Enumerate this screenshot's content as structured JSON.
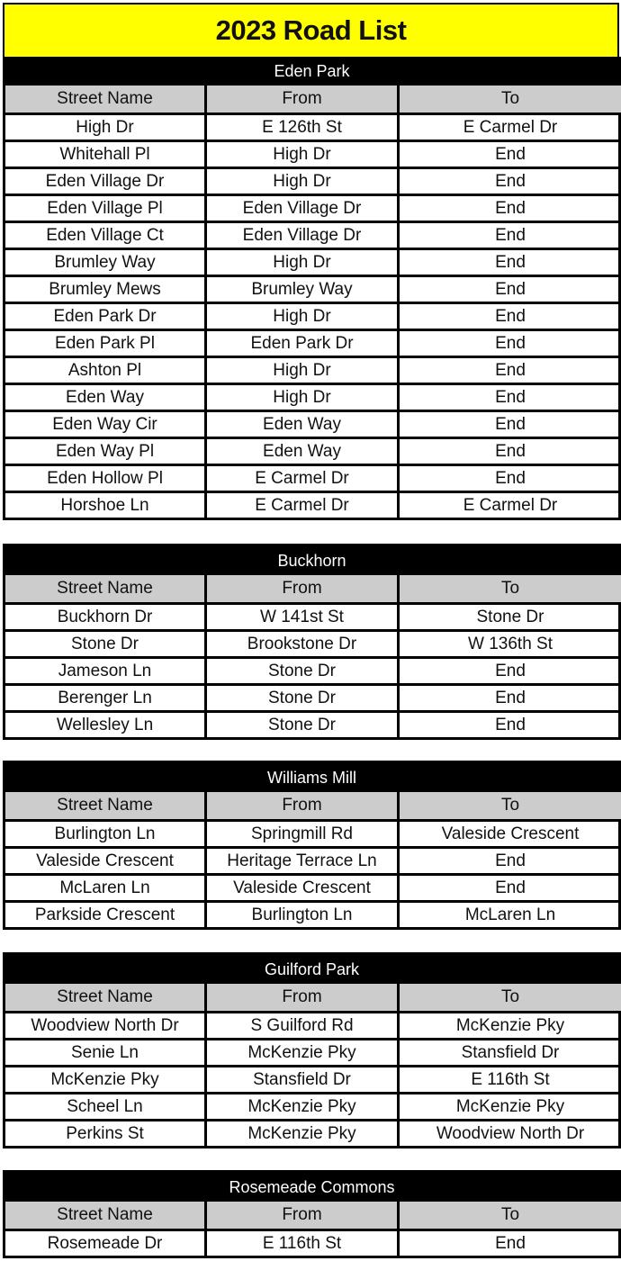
{
  "title": "2023 Road List",
  "columns": [
    "Street Name",
    "From",
    "To"
  ],
  "sections": [
    {
      "name": "Eden Park",
      "rows": [
        [
          "High Dr",
          "E 126th St",
          "E Carmel Dr"
        ],
        [
          "Whitehall Pl",
          "High Dr",
          "End"
        ],
        [
          "Eden Village Dr",
          "High Dr",
          "End"
        ],
        [
          "Eden Village Pl",
          "Eden Village Dr",
          "End"
        ],
        [
          "Eden Village Ct",
          "Eden Village Dr",
          "End"
        ],
        [
          "Brumley Way",
          "High Dr",
          "End"
        ],
        [
          "Brumley Mews",
          "Brumley Way",
          "End"
        ],
        [
          "Eden Park Dr",
          "High Dr",
          "End"
        ],
        [
          "Eden Park Pl",
          "Eden Park Dr",
          "End"
        ],
        [
          "Ashton Pl",
          "High Dr",
          "End"
        ],
        [
          "Eden Way",
          "High Dr",
          "End"
        ],
        [
          "Eden Way Cir",
          "Eden Way",
          "End"
        ],
        [
          "Eden Way Pl",
          "Eden Way",
          "End"
        ],
        [
          "Eden Hollow Pl",
          "E Carmel Dr",
          "End"
        ],
        [
          "Horshoe Ln",
          "E Carmel Dr",
          "E Carmel Dr"
        ]
      ]
    },
    {
      "name": "Buckhorn",
      "rows": [
        [
          "Buckhorn Dr",
          "W 141st St",
          "Stone Dr"
        ],
        [
          "Stone Dr",
          "Brookstone Dr",
          "W 136th St"
        ],
        [
          "Jameson Ln",
          "Stone Dr",
          "End"
        ],
        [
          "Berenger Ln",
          "Stone Dr",
          "End"
        ],
        [
          "Wellesley Ln",
          "Stone Dr",
          "End"
        ]
      ]
    },
    {
      "name": "Williams Mill",
      "rows": [
        [
          "Burlington Ln",
          "Springmill Rd",
          "Valeside Crescent"
        ],
        [
          "Valeside Crescent",
          "Heritage Terrace Ln",
          "End"
        ],
        [
          "McLaren Ln",
          "Valeside Crescent",
          "End"
        ],
        [
          "Parkside Crescent",
          "Burlington Ln",
          "McLaren Ln"
        ]
      ]
    },
    {
      "name": "Guilford Park",
      "rows": [
        [
          "Woodview North Dr",
          "S Guilford Rd",
          "McKenzie Pky"
        ],
        [
          "Senie Ln",
          "McKenzie Pky",
          "Stansfield Dr"
        ],
        [
          "McKenzie Pky",
          "Stansfield Dr",
          "E 116th St"
        ],
        [
          "Scheel Ln",
          "McKenzie Pky",
          "McKenzie Pky"
        ],
        [
          "Perkins St",
          "McKenzie Pky",
          "Woodview North Dr"
        ]
      ]
    },
    {
      "name": "Rosemeade Commons",
      "rows": [
        [
          "Rosemeade Dr",
          "E 116th St",
          "End"
        ]
      ]
    }
  ],
  "colors": {
    "title_background": "#ffff00",
    "section_header_background": "#000000",
    "column_header_background": "#cccccc"
  }
}
